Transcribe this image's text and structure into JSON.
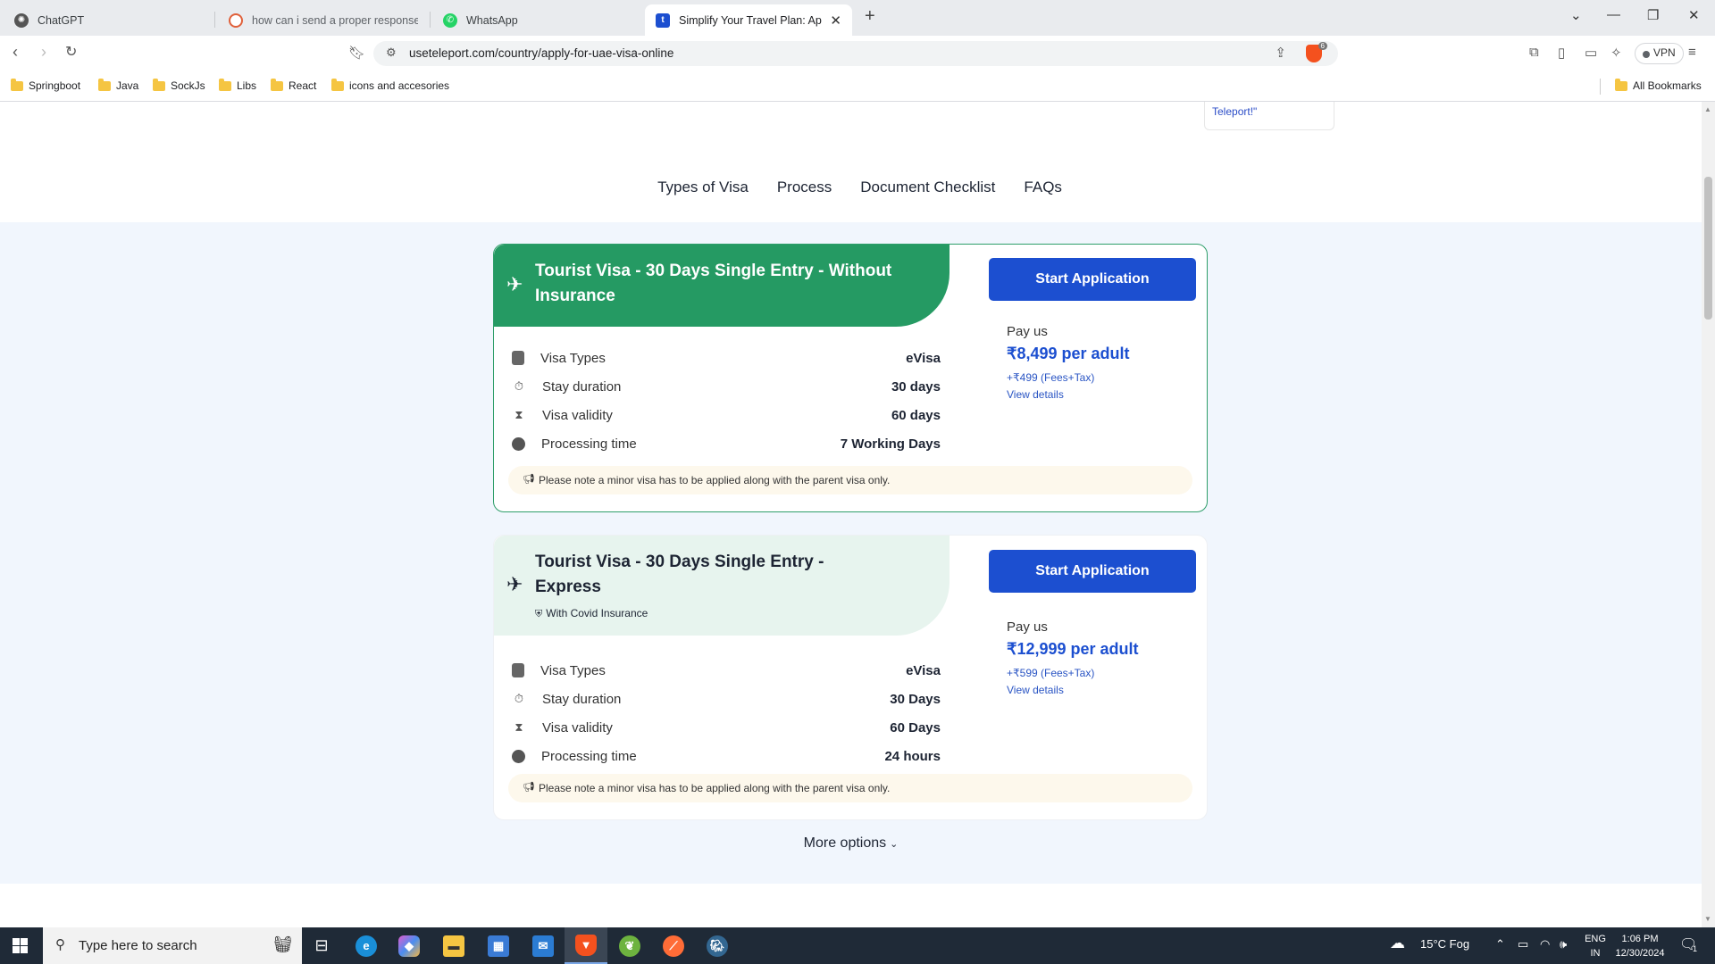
{
  "browser": {
    "tabs": [
      {
        "label": "ChatGPT",
        "active": false,
        "favicon_color": "#444444"
      },
      {
        "label": "how can i send a proper response i",
        "active": false,
        "favicon_color": "#e0603a"
      },
      {
        "label": "WhatsApp",
        "active": false,
        "favicon_color": "#25d366"
      },
      {
        "label": "Simplify Your Travel Plan: Apply",
        "active": true,
        "favicon_color": "#1c4fd0"
      }
    ],
    "active_tab_favicon_letter": "t",
    "url": "useteleport.com/country/apply-for-uae-visa-online",
    "shield_count": "6",
    "vpn_label": "VPN",
    "bookmarks": [
      "Springboot",
      "Java",
      "SockJs",
      "Libs",
      "React",
      "icons and accesories"
    ],
    "all_bookmarks_label": "All Bookmarks"
  },
  "page": {
    "review_snippet": "Teleport!\"",
    "subnav": [
      "Types of Visa",
      "Process",
      "Document Checklist",
      "FAQs"
    ],
    "visa_cards": [
      {
        "title": "Tourist Visa - 30 Days Single Entry - Without Insurance",
        "badge": "",
        "button_label": "Start Application",
        "pay_label": "Pay us",
        "price": "₹8,499 per adult",
        "fees": "+₹499 (Fees+Tax)",
        "details_link": "View details",
        "rows": [
          {
            "label": "Visa Types",
            "value": "eVisa",
            "icon": "document-icon"
          },
          {
            "label": "Stay duration",
            "value": "30 days",
            "icon": "calendar-clock-icon"
          },
          {
            "label": "Visa validity",
            "value": "60 days",
            "icon": "hourglass-icon"
          },
          {
            "label": "Processing time",
            "value": "7 Working Days",
            "icon": "clock-icon"
          }
        ],
        "note": "Please note a minor visa has to be applied along with the parent visa only."
      },
      {
        "title": "Tourist Visa - 30 Days Single Entry - Express",
        "badge": "With Covid Insurance",
        "button_label": "Start Application",
        "pay_label": "Pay us",
        "price": "₹12,999 per adult",
        "fees": "+₹599 (Fees+Tax)",
        "details_link": "View details",
        "rows": [
          {
            "label": "Visa Types",
            "value": "eVisa",
            "icon": "document-icon"
          },
          {
            "label": "Stay duration",
            "value": "30 Days",
            "icon": "calendar-clock-icon"
          },
          {
            "label": "Visa validity",
            "value": "60 Days",
            "icon": "hourglass-icon"
          },
          {
            "label": "Processing time",
            "value": "24 hours",
            "icon": "clock-icon"
          }
        ],
        "note": "Please note a minor visa has to be applied along with the parent visa only."
      }
    ],
    "more_options": "More options"
  },
  "taskbar": {
    "search_placeholder": "Type here to search",
    "weather": "15°C  Fog",
    "lang_top": "ENG",
    "lang_bottom": "IN",
    "time": "1:06 PM",
    "date": "12/30/2024",
    "notification_count": "1"
  },
  "colors": {
    "primary_blue": "#1c4fd0",
    "green_header": "#259a63",
    "light_green_header": "#e7f4ee",
    "section_bg": "#f1f6fd",
    "note_bg": "#fdf8ec"
  }
}
